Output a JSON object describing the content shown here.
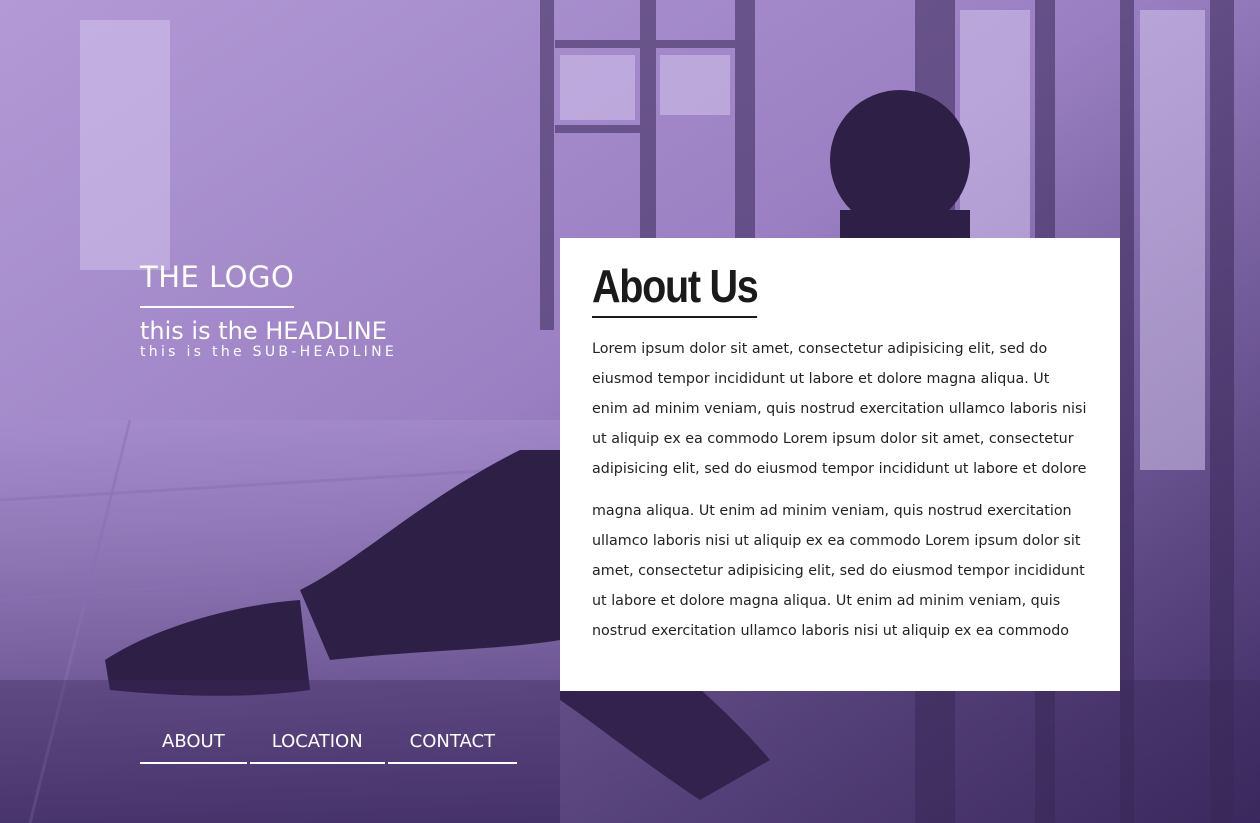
{
  "brand": {
    "logo": "THE LOGO",
    "headline": "this is the HEADLINE",
    "subheadline": "this is the SUB-HEADLINE"
  },
  "nav": {
    "items": [
      {
        "label": "ABOUT"
      },
      {
        "label": "LOCATION"
      },
      {
        "label": "CONTACT"
      }
    ]
  },
  "about": {
    "title": "About Us",
    "paragraphs": [
      "Lorem ipsum dolor sit amet, consectetur adipisicing elit, sed do eiusmod tempor incididunt ut labore et dolore magna aliqua. Ut enim ad minim veniam, quis nostrud exercitation ullamco laboris nisi ut aliquip ex ea commodo Lorem ipsum dolor sit amet, consectetur adipisicing elit, sed do eiusmod tempor incididunt ut labore et dolore",
      "magna aliqua. Ut enim ad minim veniam, quis nostrud exercitation ullamco laboris nisi ut aliquip ex ea commodo Lorem ipsum dolor sit amet, consectetur adipisicing elit, sed do eiusmod tempor incididunt ut labore et dolore magna aliqua. Ut enim ad minim veniam, quis nostrud exercitation ullamco laboris nisi ut aliquip ex ea commodo"
    ]
  },
  "colors": {
    "overlay_light": "#a48bc9",
    "overlay_dark": "#3a2758",
    "card_background": "#ffffff",
    "text_dark": "#1a1a1a"
  }
}
